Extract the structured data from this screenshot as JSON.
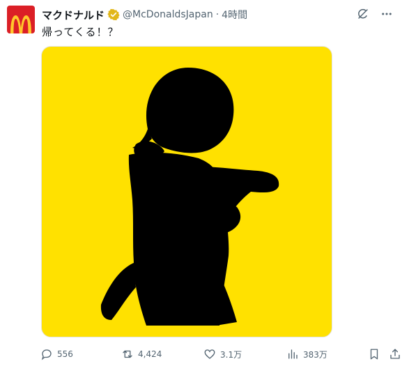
{
  "post": {
    "author_name": "マクドナルド",
    "handle": "@McDonaldsJapan",
    "separator": "·",
    "time": "4時間",
    "text": "帰ってくる！？"
  },
  "icons": {
    "avatar": "mcdonalds-logo-icon",
    "verified": "verified-badge-icon",
    "grok": "grok-icon",
    "more": "more-icon",
    "reply": "reply-icon",
    "repost": "repost-icon",
    "like": "heart-icon",
    "views": "views-icon",
    "bookmark": "bookmark-icon",
    "share": "share-icon"
  },
  "colors": {
    "avatar_bg": "#db1f26",
    "logo_yellow": "#ffc72c",
    "media_bg": "#ffe100",
    "verified_gold": "#e2b719",
    "muted": "#536471"
  },
  "actions": {
    "replies": "556",
    "reposts": "4,424",
    "likes": "3.1万",
    "views": "383万"
  }
}
